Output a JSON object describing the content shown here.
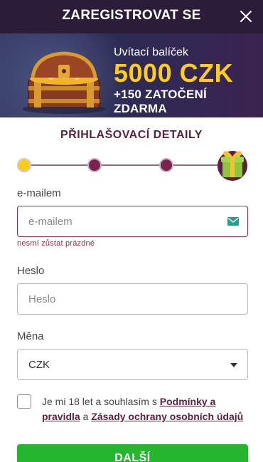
{
  "header": {
    "title": "ZAREGISTROVAT SE",
    "close_icon": "close-icon"
  },
  "banner": {
    "welcome": "Uvítací balíček",
    "amount": "5000 CZK",
    "spins": "+150 ZATOČENÍ ZDARMA"
  },
  "section": {
    "title": "PŘIHLAŠOVACÍ DETAILY"
  },
  "progress": {
    "steps": 4,
    "current_step": 1,
    "final_icon": "gift-icon"
  },
  "form": {
    "email_label": "e-mailem",
    "email_placeholder": "e-mailem",
    "email_error": "nesmí zůstat prázdné",
    "email_icon": "mail-icon",
    "password_label": "Heslo",
    "password_placeholder": "Heslo",
    "currency_label": "Měna",
    "currency_value": "CZK",
    "consent_prefix": "Je mi 18 let a souhlasím s ",
    "terms_link": "Podmínky a pravidla",
    "consent_middle": " a ",
    "privacy_link": "Zásady ochrany osobních údajů",
    "checkbox_checked": false,
    "next_button": "DALŠÍ"
  },
  "colors": {
    "header_bg": "#2b1d3a",
    "accent": "#5c1f41",
    "amount": "#ffcc1e",
    "step_active": "#ffcb14",
    "error": "#a8253e",
    "button": "#25b52e"
  }
}
